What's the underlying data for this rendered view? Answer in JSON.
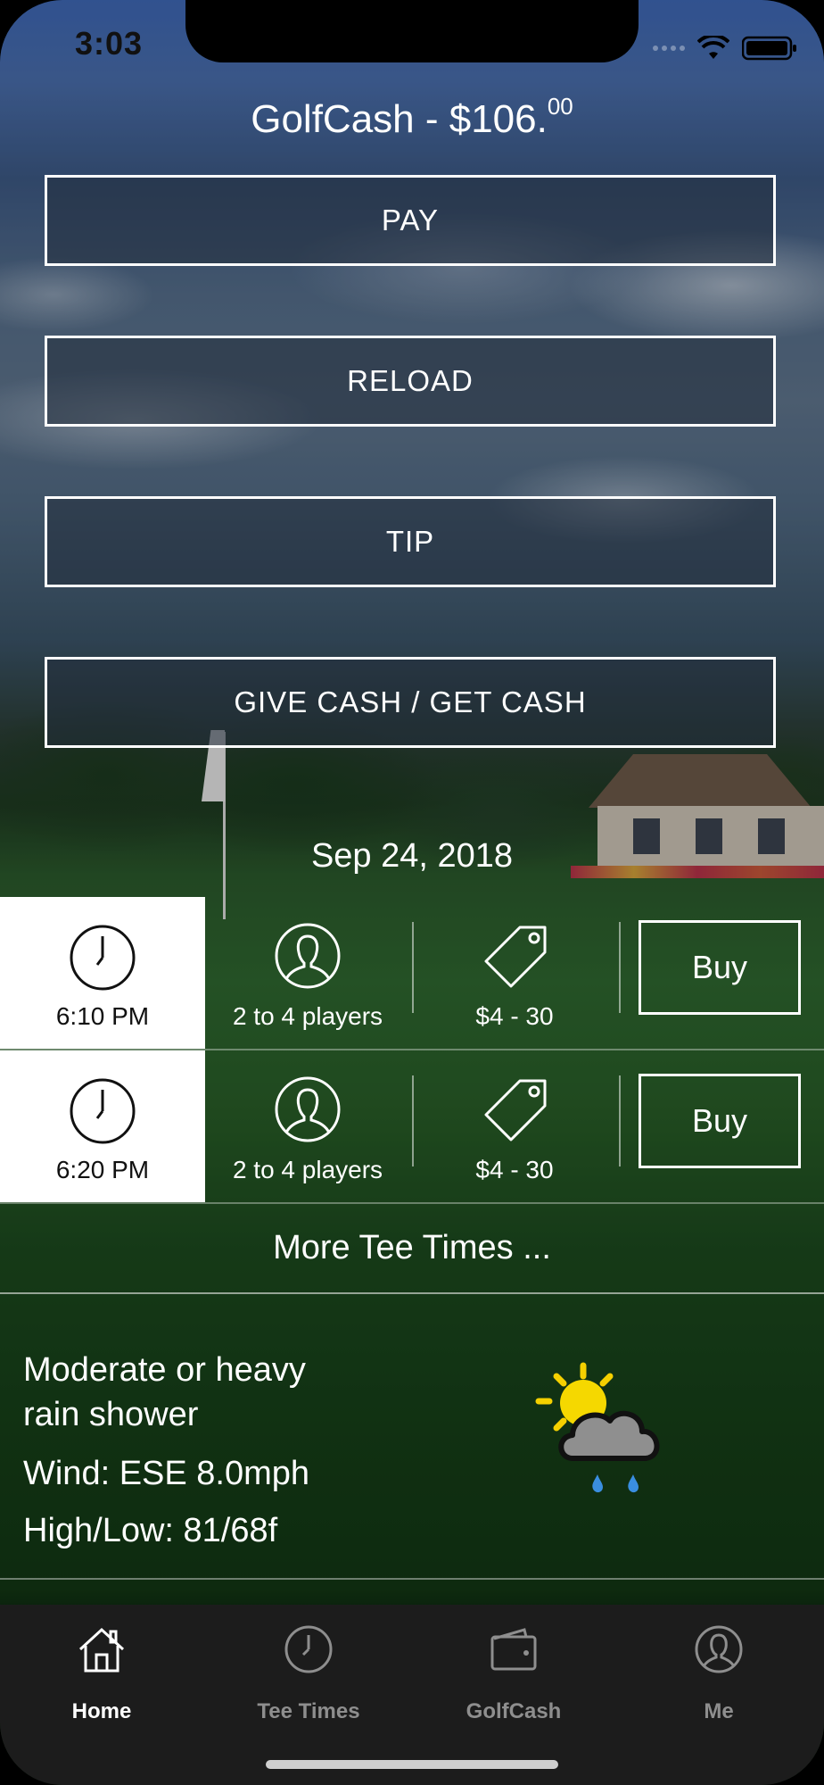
{
  "status_bar": {
    "time": "3:03"
  },
  "golfcash": {
    "title": "GolfCash - $106.",
    "cents": "00"
  },
  "actions": {
    "pay": "PAY",
    "reload": "RELOAD",
    "tip": "TIP",
    "give_get": "GIVE CASH / GET CASH"
  },
  "tee_times": {
    "date": "Sep 24, 2018",
    "rows": [
      {
        "time": "6:10 PM",
        "players": "2 to 4 players",
        "price": "$4 - 30",
        "buy": "Buy"
      },
      {
        "time": "6:20 PM",
        "players": "2 to 4 players",
        "price": "$4 - 30",
        "buy": "Buy"
      }
    ],
    "more": "More Tee Times ..."
  },
  "weather": {
    "condition_line1": "Moderate or heavy",
    "condition_line2": "rain shower",
    "wind": "Wind: ESE 8.0mph",
    "high_low": "High/Low: 81/68f",
    "icon": "sun-cloud-rain-icon"
  },
  "tabs": [
    {
      "label": "Home",
      "icon": "home-icon",
      "active": true
    },
    {
      "label": "Tee Times",
      "icon": "clock-icon",
      "active": false
    },
    {
      "label": "GolfCash",
      "icon": "wallet-icon",
      "active": false
    },
    {
      "label": "Me",
      "icon": "person-icon",
      "active": false
    }
  ],
  "colors": {
    "tab_active": "#ffffff",
    "tab_inactive": "#8e8e8e",
    "tab_bar_bg": "#1c1c1c"
  }
}
